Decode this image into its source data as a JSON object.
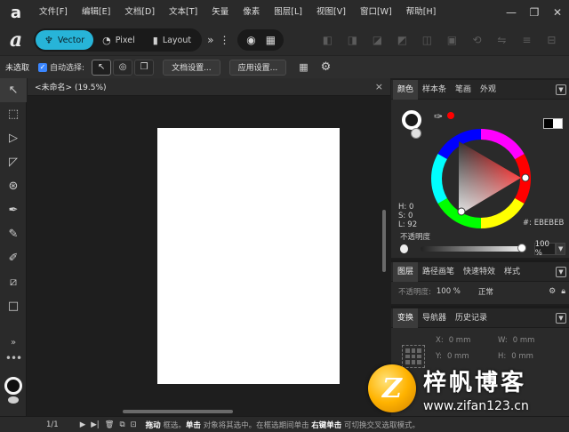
{
  "menubar": {
    "logo": "a",
    "items": [
      "文件[F]",
      "编辑[E]",
      "文档[D]",
      "文本[T]",
      "矢量",
      "像素",
      "图层[L]",
      "视图[V]",
      "窗口[W]",
      "帮助[H]"
    ],
    "window_controls": [
      "—",
      "❐",
      "✕"
    ]
  },
  "toolbar": {
    "personas": [
      {
        "label": "Vector",
        "icon": "vector-persona-icon"
      },
      {
        "label": "Pixel",
        "icon": "pixel-persona-icon"
      },
      {
        "label": "Layout",
        "icon": "layout-persona-icon"
      }
    ],
    "more": "»"
  },
  "context": {
    "selection": "未选取",
    "auto_select": "自动选择:",
    "doc_settings": "文档设置...",
    "app_settings": "应用设置..."
  },
  "document": {
    "tab": "<未命名> (19.5%)",
    "close": "×"
  },
  "color_panel": {
    "tabs": [
      "颜色",
      "样本条",
      "笔画",
      "外观"
    ],
    "h": "H: 0",
    "s": "S: 0",
    "l": "L: 92",
    "hex": "EBEBEB",
    "hex_prefix": "#:",
    "opacity_label": "不透明度",
    "opacity_value": "100 %",
    "accent": "#ff0000"
  },
  "layers_panel": {
    "tabs": [
      "图层",
      "路径画笔",
      "快速特效",
      "样式"
    ],
    "opacity_label": "不透明度:",
    "opacity_value": "100 %",
    "blend": "正常"
  },
  "transform_panel": {
    "tabs": [
      "变换",
      "导航器",
      "历史记录"
    ],
    "x": "X:",
    "x_val": "0 mm",
    "y": "Y:",
    "y_val": "0 mm",
    "w": "W:",
    "w_val": "0 mm",
    "h": "H:",
    "h_val": "0 mm"
  },
  "status": {
    "page": "1/1",
    "hint_drag": "拖动",
    "hint_1": " 框选。",
    "hint_click": "单击",
    "hint_2": " 对象将其选中。在框选期间单击 ",
    "hint_rclick": "右键单击",
    "hint_3": " 可切换交叉选取模式。"
  },
  "watermark": {
    "glyph": "Z",
    "title": "梓帆博客",
    "url": "www.zifan123.cn"
  }
}
